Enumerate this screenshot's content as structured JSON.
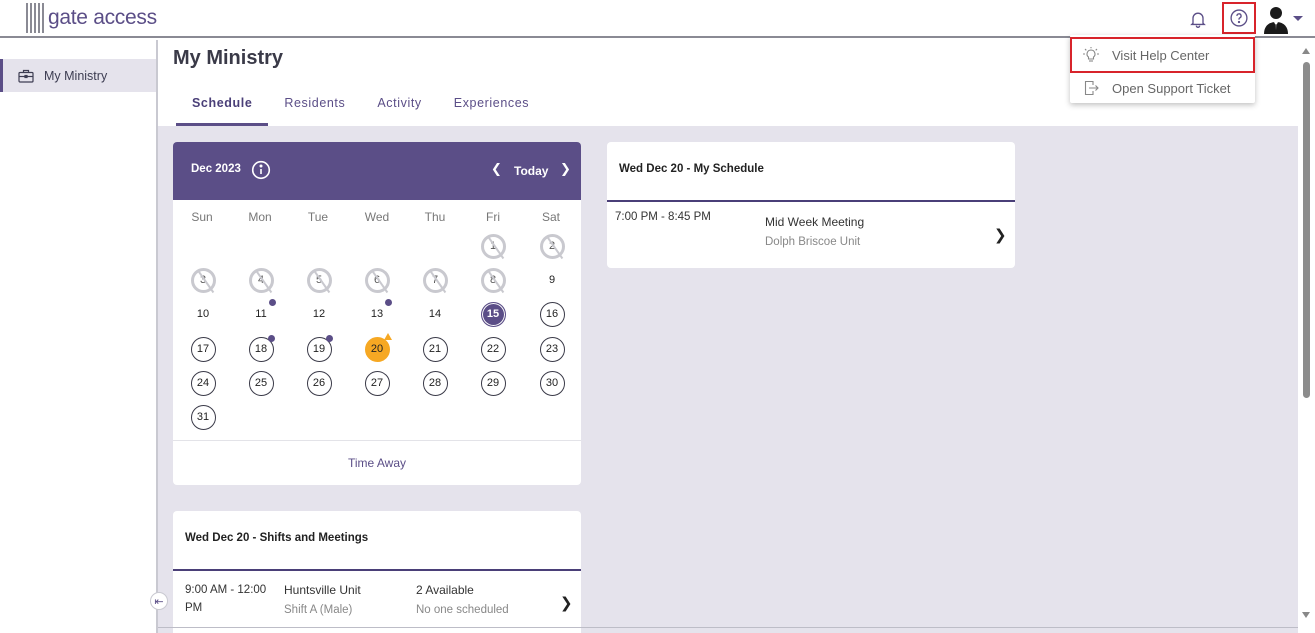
{
  "header": {
    "logo_text": "gate access",
    "icons": [
      "bell-icon",
      "help-icon",
      "avatar-icon",
      "caret-down-icon"
    ]
  },
  "sidebar": {
    "items": [
      {
        "label": "My Ministry",
        "icon": "briefcase-icon"
      }
    ]
  },
  "page": {
    "title": "My Ministry",
    "tabs": [
      {
        "label": "Schedule",
        "active": true
      },
      {
        "label": "Residents"
      },
      {
        "label": "Activity"
      },
      {
        "label": "Experiences"
      }
    ]
  },
  "calendar": {
    "month_label": "Dec 2023",
    "today_label": "Today",
    "weekdays": [
      "Sun",
      "Mon",
      "Tue",
      "Wed",
      "Thu",
      "Fri",
      "Sat"
    ],
    "days": [
      "1",
      "2",
      "3",
      "4",
      "5",
      "6",
      "7",
      "8",
      "9",
      "10",
      "11",
      "12",
      "13",
      "14",
      "15",
      "16",
      "17",
      "18",
      "19",
      "20",
      "21",
      "22",
      "23",
      "24",
      "25",
      "26",
      "27",
      "28",
      "29",
      "30",
      "31"
    ],
    "past_days": [
      1,
      2,
      3,
      4,
      5,
      6,
      7,
      8
    ],
    "selected_day": 15,
    "today_day": 20,
    "dot_days": [
      11,
      13,
      18,
      19
    ],
    "footer_label": "Time Away",
    "accent_color": "#5b4e87",
    "today_color": "#f6a823"
  },
  "my_schedule": {
    "title": "Wed Dec 20 - My Schedule",
    "rows": [
      {
        "time": "7:00 PM - 8:45 PM",
        "name": "Mid Week Meeting",
        "location": "Dolph Briscoe Unit"
      }
    ]
  },
  "shifts": {
    "title": "Wed Dec 20 - Shifts and Meetings",
    "rows": [
      {
        "time_line1": "9:00 AM - 12:00",
        "time_line2": "PM",
        "unit": "Huntsville Unit",
        "shift": "Shift A (Male)",
        "available": "2 Available",
        "scheduled": "No one scheduled"
      }
    ]
  },
  "help_menu": {
    "items": [
      {
        "label": "Visit Help Center",
        "icon": "lightbulb-icon"
      },
      {
        "label": "Open Support Ticket",
        "icon": "ticket-export-icon"
      }
    ]
  }
}
